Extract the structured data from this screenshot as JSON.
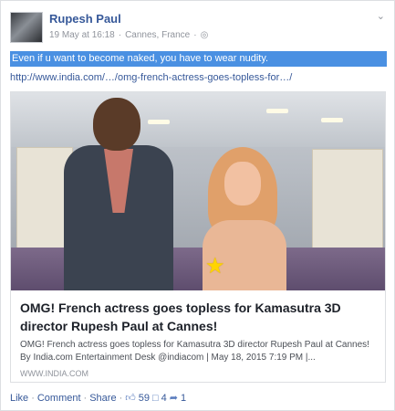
{
  "post": {
    "author": "Rupesh Paul",
    "date": "19 May at 16:18",
    "separator": "·",
    "location": "Cannes, France",
    "status_text": "Even if u want to become naked, you have to wear nudity.",
    "link_text": "http://www.india.com/…/omg-french-actress-goes-topless-for…/"
  },
  "card": {
    "title": "OMG! French actress goes topless for Kamasutra 3D director Rupesh Paul at Cannes!",
    "description": "OMG! French actress goes topless for Kamasutra 3D director Rupesh Paul at Cannes! By India.com Entertainment Desk @indiacom | May 18, 2015 7:19 PM |...",
    "domain": "WWW.INDIA.COM"
  },
  "actions": {
    "like": "Like",
    "comment": "Comment",
    "share": "Share",
    "dot": "·",
    "like_count": "59",
    "comment_count": "4",
    "share_count": "1"
  },
  "icons": {
    "globe": "globe-icon",
    "chevron": "chevron-down-icon",
    "like": "thumbs-up-icon",
    "comment": "comment-icon",
    "share": "share-icon",
    "censor": "star-icon"
  },
  "colors": {
    "link_blue": "#365899",
    "highlight_blue": "#4a90e2",
    "censor_star": "#ffd400"
  }
}
